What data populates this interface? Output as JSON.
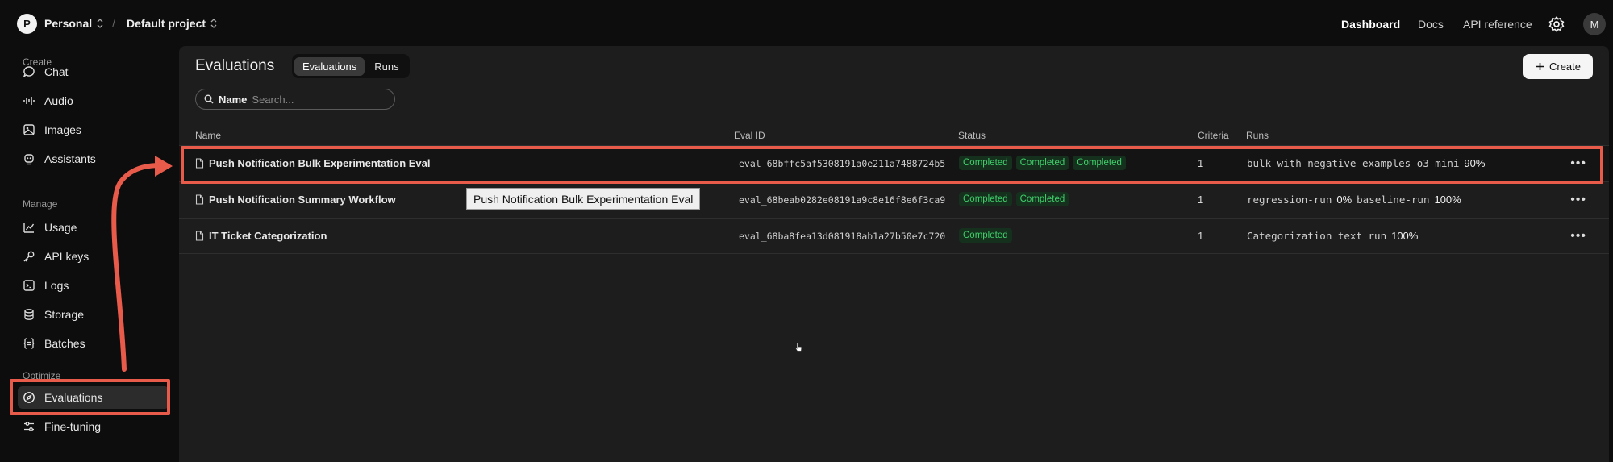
{
  "topbar": {
    "org_initial": "P",
    "org_name": "Personal",
    "project_name": "Default project",
    "nav": [
      "Dashboard",
      "Docs",
      "API reference"
    ],
    "user_initial": "M"
  },
  "sidebar": {
    "sections": [
      {
        "label": "Create",
        "items": [
          {
            "label": "Chat",
            "icon": "chat-bubble-icon"
          },
          {
            "label": "Audio",
            "icon": "audio-waveform-icon"
          },
          {
            "label": "Images",
            "icon": "image-icon"
          },
          {
            "label": "Assistants",
            "icon": "assistant-robot-icon"
          }
        ]
      },
      {
        "label": "Manage",
        "items": [
          {
            "label": "Usage",
            "icon": "usage-chart-icon"
          },
          {
            "label": "API keys",
            "icon": "key-icon"
          },
          {
            "label": "Logs",
            "icon": "terminal-icon"
          },
          {
            "label": "Storage",
            "icon": "database-icon"
          },
          {
            "label": "Batches",
            "icon": "braces-icon"
          }
        ]
      },
      {
        "label": "Optimize",
        "items": [
          {
            "label": "Evaluations",
            "icon": "compass-icon",
            "active": true
          },
          {
            "label": "Fine-tuning",
            "icon": "sliders-icon"
          }
        ]
      }
    ]
  },
  "main": {
    "title": "Evaluations",
    "tabs": [
      {
        "label": "Evaluations",
        "active": true
      },
      {
        "label": "Runs",
        "active": false
      }
    ],
    "create_label": "Create",
    "search": {
      "label": "Name",
      "placeholder": "Search..."
    },
    "columns": [
      "Name",
      "Eval ID",
      "Status",
      "Criteria",
      "Runs"
    ],
    "rows": [
      {
        "name": "Push Notification Bulk Experimentation Eval",
        "eval_id": "eval_68bffc5af5308191a0e211a7488724b5",
        "statuses": [
          "Completed",
          "Completed",
          "Completed"
        ],
        "criteria": "1",
        "runs": [
          {
            "name": "bulk_with_negative_examples_o3-mini",
            "pct": "90%"
          }
        ]
      },
      {
        "name": "Push Notification Summary Workflow",
        "eval_id": "eval_68beab0282e08191a9c8e16f8e6f3ca9",
        "statuses": [
          "Completed",
          "Completed"
        ],
        "criteria": "1",
        "runs": [
          {
            "name": "regression-run",
            "pct": "0%"
          },
          {
            "name": "baseline-run",
            "pct": "100%"
          }
        ]
      },
      {
        "name": "IT Ticket Categorization",
        "eval_id": "eval_68ba8fea13d081918ab1a27b50e7c720",
        "statuses": [
          "Completed"
        ],
        "criteria": "1",
        "runs": [
          {
            "name": "Categorization text run",
            "pct": "100%"
          }
        ]
      }
    ],
    "tooltip": "Push Notification Bulk Experimentation Eval"
  },
  "colors": {
    "annotation": "#e85a4a",
    "status_green": "#3fd06a",
    "panel": "#1d1d1d"
  }
}
